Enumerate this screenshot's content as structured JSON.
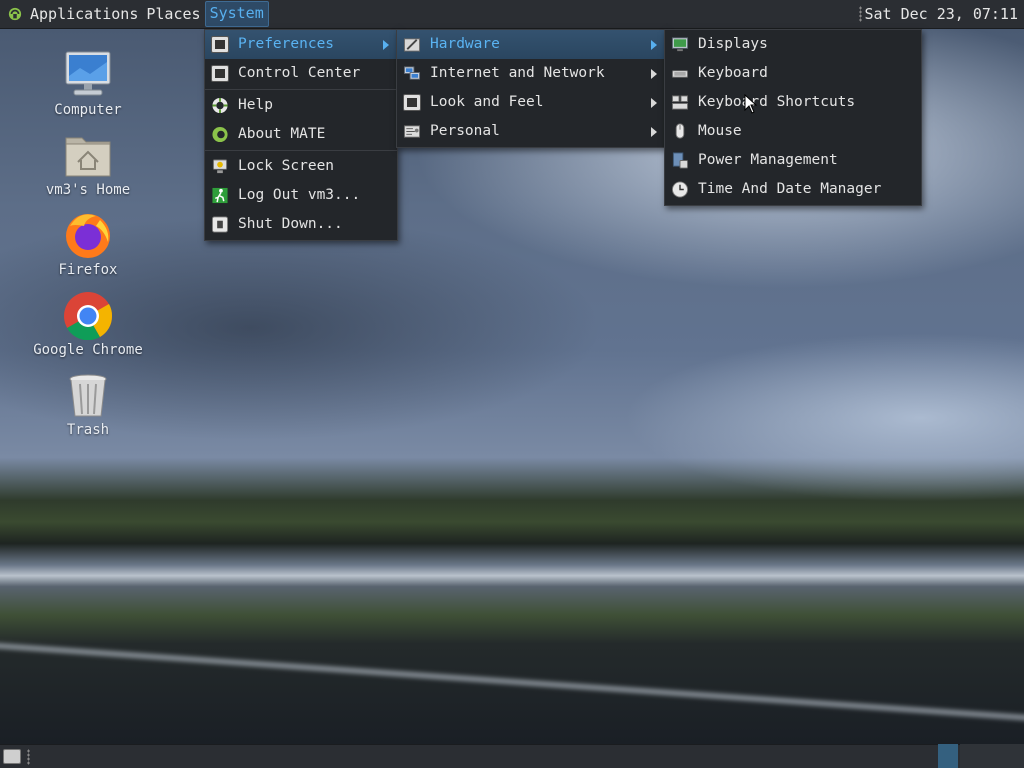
{
  "top_panel": {
    "menus": [
      {
        "label": "Applications"
      },
      {
        "label": "Places"
      },
      {
        "label": "System"
      }
    ],
    "clock": "Sat Dec 23, 07:11"
  },
  "desktop_icons": [
    {
      "label": "Computer",
      "icon": "computer-icon"
    },
    {
      "label": "vm3's Home",
      "icon": "home-folder-icon"
    },
    {
      "label": "Firefox",
      "icon": "firefox-icon"
    },
    {
      "label": "Google Chrome",
      "icon": "chrome-icon"
    },
    {
      "label": "Trash",
      "icon": "trash-icon"
    }
  ],
  "system_menu": {
    "items": [
      {
        "label": "Preferences",
        "icon": "preferences-icon",
        "submenu": true,
        "highlighted": true
      },
      {
        "label": "Control Center",
        "icon": "control-center-icon"
      },
      {
        "label": "Help",
        "icon": "help-icon"
      },
      {
        "label": "About MATE",
        "icon": "mate-logo-icon"
      },
      {
        "label": "Lock Screen",
        "icon": "lock-screen-icon"
      },
      {
        "label": "Log Out vm3...",
        "icon": "log-out-icon"
      },
      {
        "label": "Shut Down...",
        "icon": "shut-down-icon"
      }
    ]
  },
  "preferences_menu": {
    "items": [
      {
        "label": "Hardware",
        "icon": "hardware-icon",
        "submenu": true,
        "highlighted": true
      },
      {
        "label": "Internet and Network",
        "icon": "network-icon",
        "submenu": true
      },
      {
        "label": "Look and Feel",
        "icon": "appearance-icon",
        "submenu": true
      },
      {
        "label": "Personal",
        "icon": "personal-icon",
        "submenu": true
      }
    ]
  },
  "hardware_menu": {
    "items": [
      {
        "label": "Displays",
        "icon": "display-icon"
      },
      {
        "label": "Keyboard",
        "icon": "keyboard-icon"
      },
      {
        "label": "Keyboard Shortcuts",
        "icon": "keyboard-shortcuts-icon"
      },
      {
        "label": "Mouse",
        "icon": "mouse-icon"
      },
      {
        "label": "Power Management",
        "icon": "power-management-icon"
      },
      {
        "label": "Time And Date Manager",
        "icon": "clock-icon"
      }
    ]
  },
  "colors": {
    "highlight_text": "#58b0ef",
    "panel_bg": "#2b2e33",
    "menu_bg": "#23262a"
  }
}
